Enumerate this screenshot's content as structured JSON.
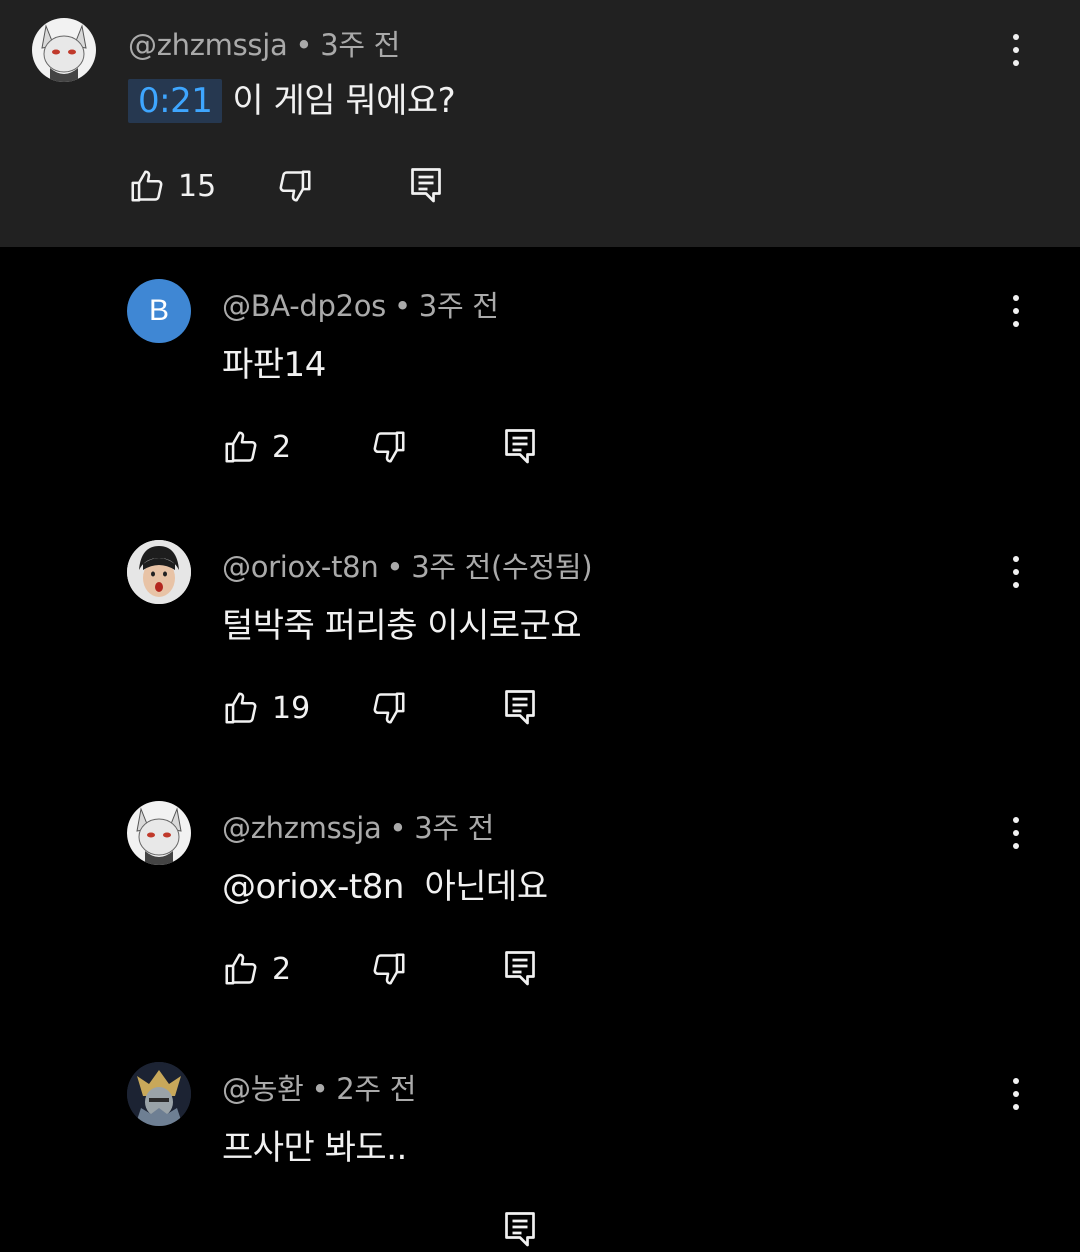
{
  "comments": [
    {
      "handle": "@zhzmssja",
      "time": "3주 전",
      "timestamp": "0:21",
      "text": "이 게임 뭐에요?",
      "likes": "15",
      "avatar": "wolf-avatar"
    },
    {
      "handle": "@BA-dp2os",
      "time": "3주 전",
      "text": "파판14",
      "likes": "2",
      "avatar_letter": "B",
      "avatar_color": "#3f87d4"
    },
    {
      "handle": "@oriox-t8n",
      "time": "3주 전(수정됨)",
      "text": "털박죽 퍼리충 이시로군요",
      "likes": "19",
      "avatar": "photo-avatar"
    },
    {
      "handle": "@zhzmssja",
      "time": "3주 전",
      "text": "@oriox-t8n  아닌데요",
      "likes": "2",
      "avatar": "wolf-avatar"
    },
    {
      "handle": "@농환",
      "time": "2주 전",
      "text": "프사만 봐도..",
      "avatar": "armored-character-avatar"
    }
  ],
  "icons": {
    "like": "thumbs-up-icon",
    "dislike": "thumbs-down-icon",
    "reply": "reply-icon",
    "more": "more-vert-icon"
  },
  "colors": {
    "timestamp_text": "#3ea6ff",
    "timestamp_bg": "#263850",
    "top_bg": "#212121",
    "page_bg": "#000000"
  }
}
